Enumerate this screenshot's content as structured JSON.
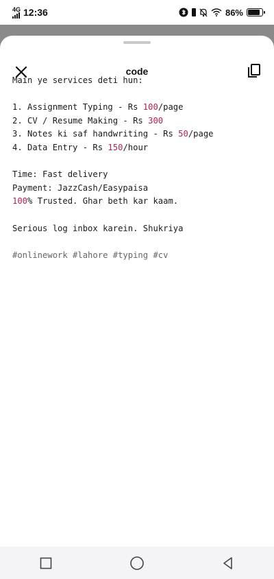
{
  "status_bar": {
    "network": "4G",
    "time": "12:36",
    "battery": "86%",
    "battery_level": 0.86
  },
  "sheet": {
    "title": "code"
  },
  "code_lines": [
    [
      {
        "t": "Main ye services deti hun:"
      }
    ],
    [],
    [
      {
        "t": "1. Assignment Typing - Rs "
      },
      {
        "t": "100",
        "n": true
      },
      {
        "t": "/page"
      }
    ],
    [
      {
        "t": "2. CV / Resume Making - Rs "
      },
      {
        "t": "300",
        "n": true
      }
    ],
    [
      {
        "t": "3. Notes ki saf handwriting - Rs "
      },
      {
        "t": "50",
        "n": true
      },
      {
        "t": "/page"
      }
    ],
    [
      {
        "t": "4. Data Entry - Rs "
      },
      {
        "t": "150",
        "n": true
      },
      {
        "t": "/hour"
      }
    ],
    [],
    [
      {
        "t": "Time: Fast delivery"
      }
    ],
    [
      {
        "t": "Payment: JazzCash/Easypaisa"
      }
    ],
    [
      {
        "t": "100",
        "n": true
      },
      {
        "t": "% Trusted. Ghar beth kar kaam."
      }
    ],
    [],
    [
      {
        "t": "Serious log inbox karein. Shukriya"
      }
    ],
    [],
    [
      {
        "t": "#onlinework #lahore #typing #cv",
        "h": true
      }
    ]
  ]
}
